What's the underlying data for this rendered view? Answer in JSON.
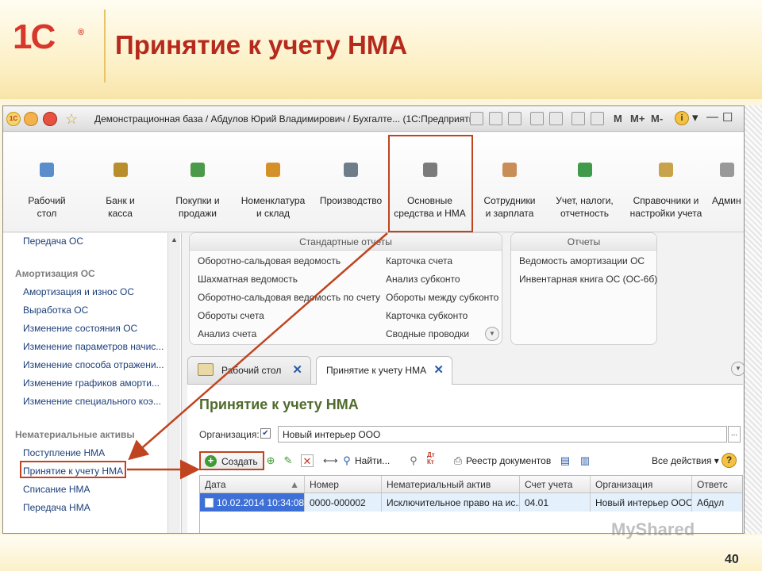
{
  "slide": {
    "logo": "1С",
    "logo_reg": "®",
    "title": "Принятие к учету НМА",
    "page_number": "40",
    "watermark": "MyShared"
  },
  "window": {
    "title": "Демонстрационная база / Абдулов Юрий Владимирович / Бухгалте... (1С:Предприятие)",
    "toolbar_text": [
      "M",
      "M+",
      "M-"
    ]
  },
  "sections": [
    {
      "label_1": "Рабочий",
      "label_2": "стол",
      "icon": "desktop-icon",
      "color": "#5b8ccc"
    },
    {
      "label_1": "Банк и",
      "label_2": "касса",
      "icon": "bank-icon",
      "color": "#b88f2c"
    },
    {
      "label_1": "Покупки и",
      "label_2": "продажи",
      "icon": "cart-icon",
      "color": "#4b9a4a"
    },
    {
      "label_1": "Номенклатура",
      "label_2": "и склад",
      "icon": "warehouse-icon",
      "color": "#d4912a"
    },
    {
      "label_1": "Производство",
      "label_2": "",
      "icon": "production-icon",
      "color": "#6f7d8a"
    },
    {
      "label_1": "Основные",
      "label_2": "средства и НМА",
      "icon": "assets-icon",
      "color": "#7b7b7b"
    },
    {
      "label_1": "Сотрудники",
      "label_2": "и зарплата",
      "icon": "staff-icon",
      "color": "#c98d58"
    },
    {
      "label_1": "Учет, налоги,",
      "label_2": "отчетность",
      "icon": "taxes-icon",
      "color": "#3f9b4a"
    },
    {
      "label_1": "Справочники и",
      "label_2": "настройки учета",
      "icon": "reference-icon",
      "color": "#c9a34c"
    },
    {
      "label_1": "Админ",
      "label_2": "",
      "icon": "admin-icon",
      "color": "#999999"
    }
  ],
  "left_nav": {
    "top_item": "Передача ОС",
    "group_1": "Амортизация ОС",
    "group_1_items": [
      "Амортизация и износ ОС",
      "Выработка ОС",
      "Изменение состояния ОС",
      "Изменение параметров начис...",
      "Изменение способа отражени...",
      "Изменение графиков аморти...",
      "Изменение специального коэ..."
    ],
    "group_2": "Нематериальные активы",
    "group_2_items": [
      "Поступление НМА",
      "Принятие к учету НМА",
      "Списание НМА",
      "Передача НМА"
    ]
  },
  "standard_reports": {
    "title": "Стандартные отчеты",
    "left": [
      "Оборотно-сальдовая ведомость",
      "Шахматная ведомость",
      "Оборотно-сальдовая ведомость по счету",
      "Обороты счета",
      "Анализ счета"
    ],
    "right": [
      "Карточка счета",
      "Анализ субконто",
      "Обороты между субконто",
      "Карточка субконто",
      "Сводные проводки"
    ]
  },
  "reports": {
    "title": "Отчеты",
    "items": [
      "Ведомость амортизации ОС",
      "Инвентарная книга ОС (ОС-6б)"
    ]
  },
  "tabs": [
    {
      "label": "Рабочий стол"
    },
    {
      "label": "Принятие к учету НМА"
    }
  ],
  "form": {
    "title": "Принятие к учету НМА",
    "org_label": "Организация:",
    "org_value": "Новый интерьер ООО",
    "create_label": "Создать",
    "find_label": "Найти...",
    "registry_label": "Реестр документов",
    "all_actions_label": "Все действия",
    "dt_kt_1": "Дт",
    "dt_kt_2": "Кт"
  },
  "table": {
    "columns": [
      "Дата",
      "Номер",
      "Нематериальный актив",
      "Счет учета",
      "Организация",
      "Ответс"
    ],
    "rows": [
      [
        "10.02.2014 10:34:08",
        "0000-000002",
        "Исключительное право на ис...",
        "04.01",
        "Новый интерьер ООО",
        "Абдул"
      ]
    ]
  },
  "colors": {
    "accent_red": "#c0441f",
    "title_red": "#b52a1c",
    "form_title_green": "#4f6b2d",
    "selection_blue": "#3d6fd6"
  }
}
